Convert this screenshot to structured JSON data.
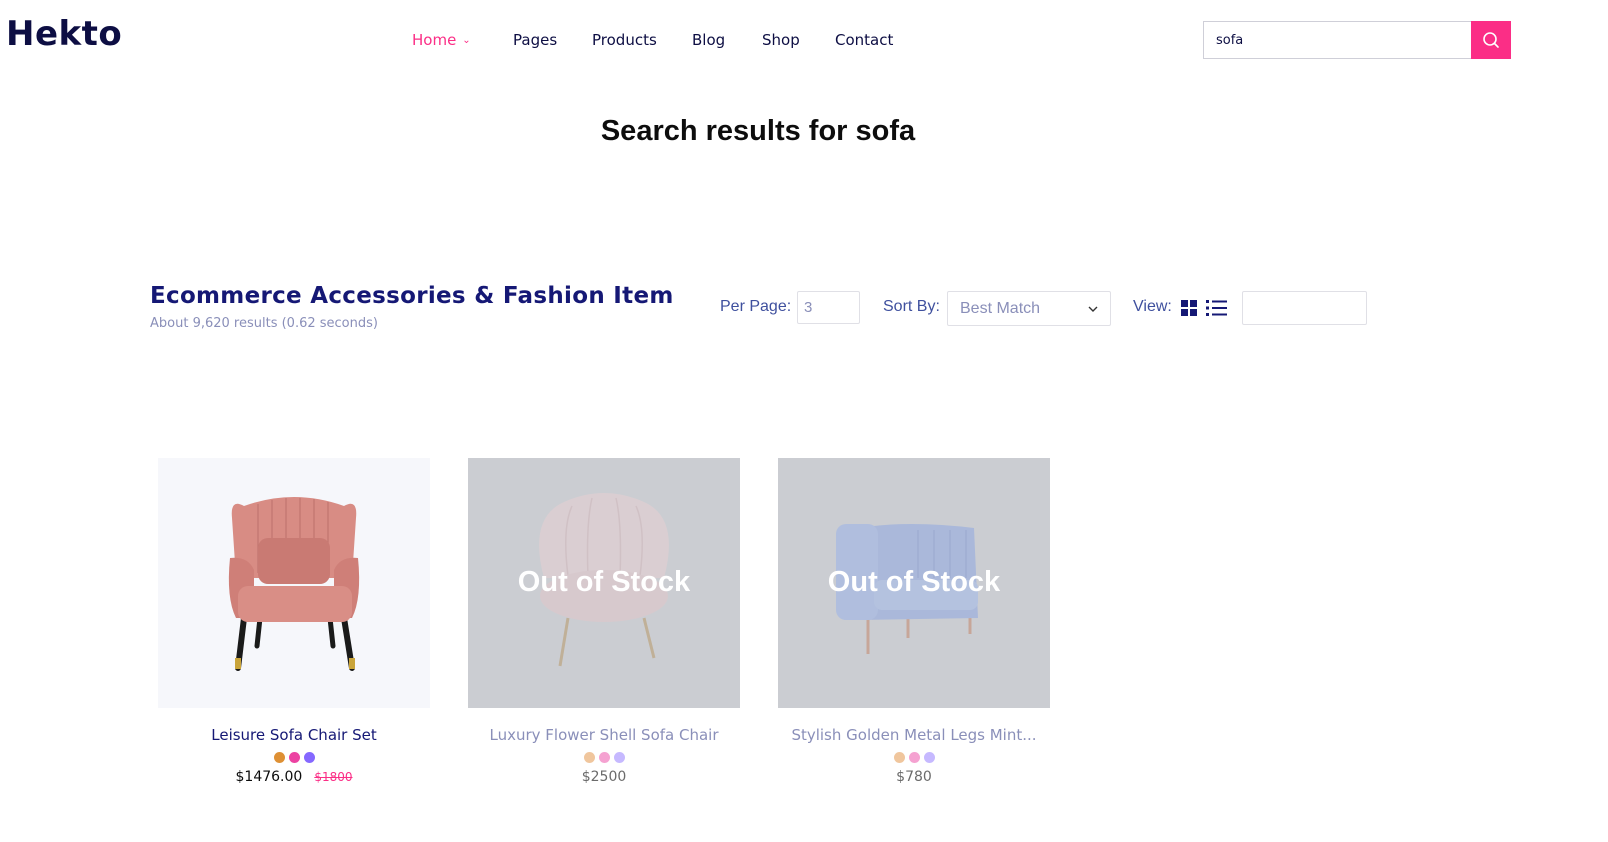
{
  "brand": {
    "logo_text": "Hekto",
    "accent_color": "#fb2e86",
    "navy_color": "#151875"
  },
  "nav": {
    "items": [
      {
        "label": "Home",
        "active": true,
        "has_dropdown": true
      },
      {
        "label": "Pages"
      },
      {
        "label": "Products"
      },
      {
        "label": "Blog"
      },
      {
        "label": "Shop"
      },
      {
        "label": "Contact"
      }
    ]
  },
  "search": {
    "value": "sofa",
    "button_icon": "search-icon"
  },
  "page": {
    "title": "Search results for sofa"
  },
  "listing": {
    "title": "Ecommerce Accessories & Fashion Item",
    "stats": "About 9,620 results (0.62 seconds)",
    "per_page_label": "Per Page:",
    "per_page_value": "3",
    "sort_label": "Sort By:",
    "sort_value": "Best Match",
    "view_label": "View:",
    "view_icons": [
      "grid-view-icon",
      "list-view-icon"
    ]
  },
  "products": [
    {
      "name": "Leisure Sofa Chair Set",
      "price": "$1476.00",
      "old_price": "$1800",
      "in_stock": true,
      "image": "pink-armchair",
      "swatches": [
        "#de9034",
        "#ec42a2",
        "#8568ff"
      ]
    },
    {
      "name": "Luxury Flower Shell Sofa Chair",
      "price": "$2500",
      "old_price": "",
      "in_stock": false,
      "stock_label": "Out of Stock",
      "image": "shell-chair",
      "swatches": [
        "#f0c69d",
        "#f5a2d1",
        "#c6b9ff"
      ]
    },
    {
      "name": "Stylish Golden Metal Legs Mint...",
      "price": "$780",
      "old_price": "",
      "in_stock": false,
      "stock_label": "Out of Stock",
      "image": "blue-armchair",
      "swatches": [
        "#f0c69d",
        "#f5a2d1",
        "#c6b9ff"
      ]
    }
  ]
}
